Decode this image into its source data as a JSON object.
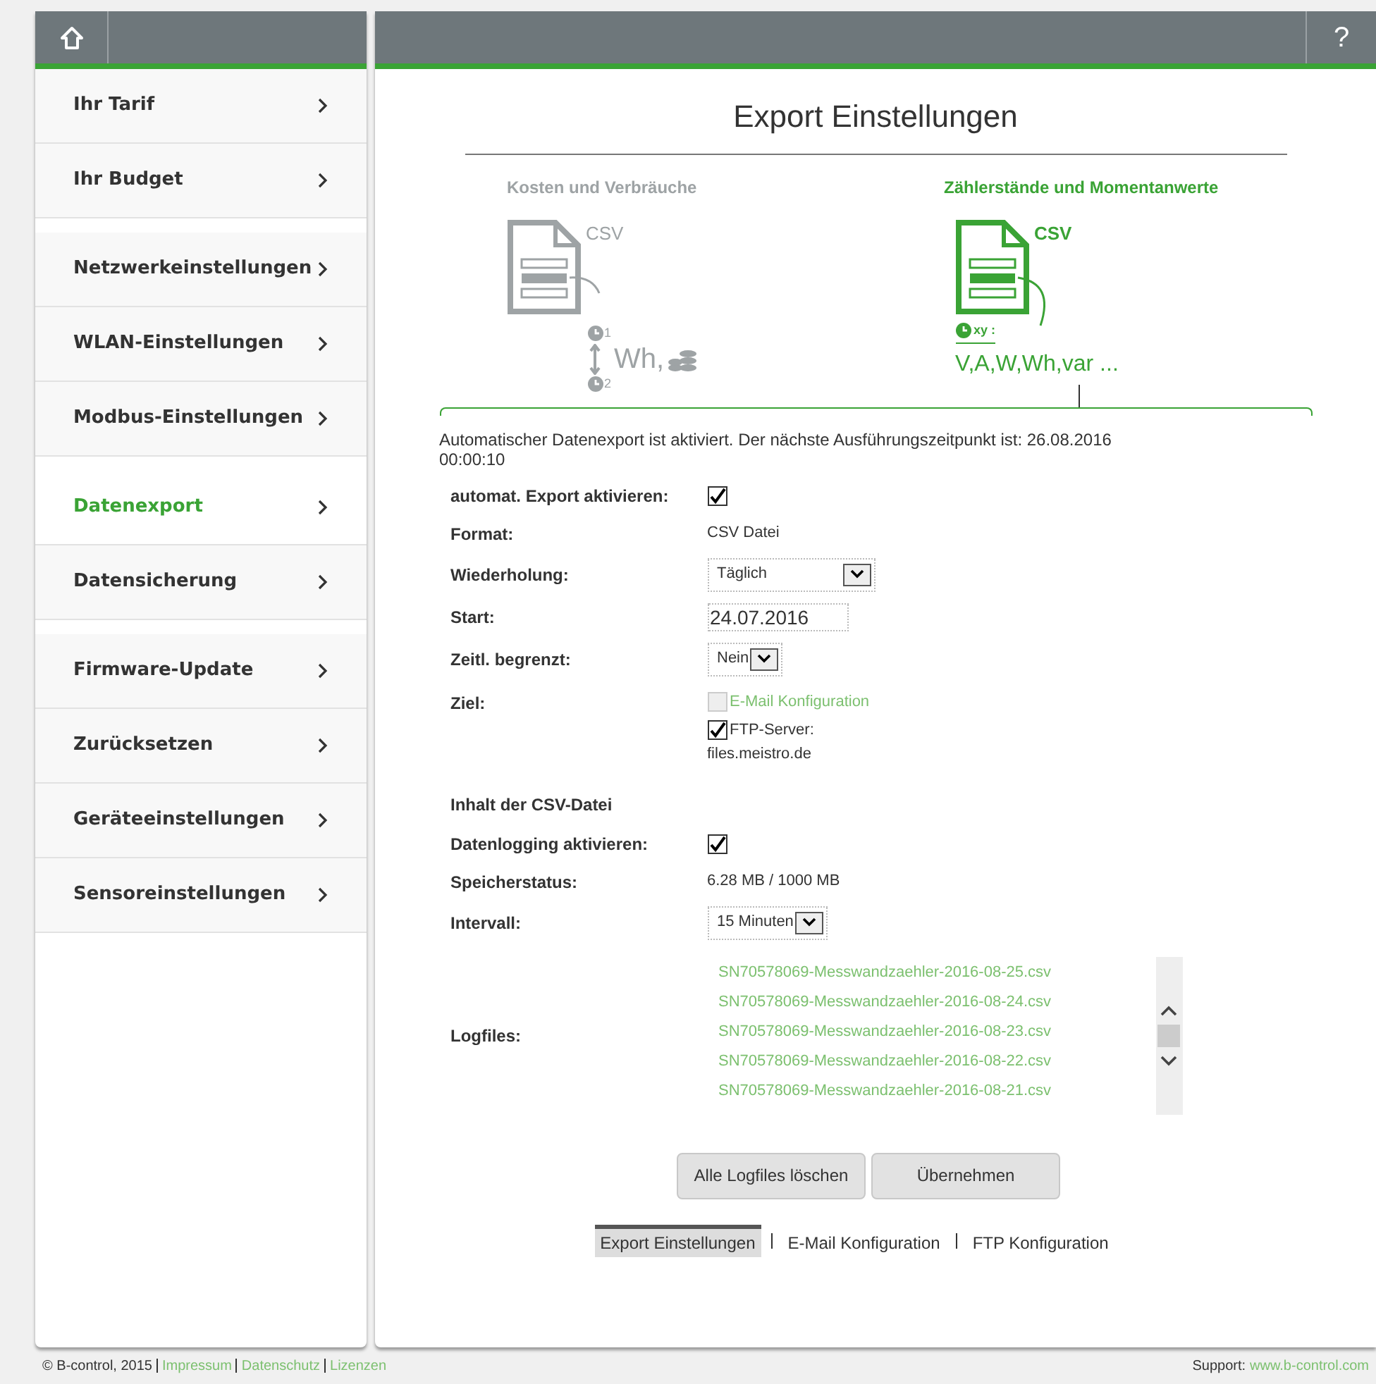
{
  "header": {
    "help": "?"
  },
  "sidebar": {
    "items": [
      {
        "label": "Ihr Tarif",
        "selected": false
      },
      {
        "label": "Ihr Budget",
        "selected": false
      },
      {
        "label": "Netzwerkeinstellungen",
        "selected": false
      },
      {
        "label": "WLAN-Einstellungen",
        "selected": false
      },
      {
        "label": "Modbus-Einstellungen",
        "selected": false
      },
      {
        "label": "Datenexport",
        "selected": true
      },
      {
        "label": "Datensicherung",
        "selected": false
      },
      {
        "label": "Firmware-Update",
        "selected": false
      },
      {
        "label": "Zurücksetzen",
        "selected": false
      },
      {
        "label": "Geräteeinstellungen",
        "selected": false
      },
      {
        "label": "Sensoreinstellungen",
        "selected": false
      }
    ]
  },
  "title": "Export Einstellungen",
  "export_types": [
    {
      "kind": "costs",
      "title": "Kosten und Verbräuche",
      "selected": false,
      "file_label": "CSV",
      "time_start": "1",
      "time_end": "2",
      "unit": "Wh,"
    },
    {
      "kind": "readings",
      "title": "Zählerstände und Momentanwerte",
      "selected": true,
      "file_label": "CSV",
      "time_label": "xy :",
      "units": "V,A,W,Wh,var ..."
    }
  ],
  "status_text": "Automatischer Datenexport ist aktiviert. Der nächste Ausführungszeitpunkt ist: 26.08.2016 00:00:10",
  "form": [
    {
      "kind": "checkbox",
      "label": "automat. Export aktivieren:",
      "checked": true
    },
    {
      "kind": "text",
      "label": "Format:",
      "value": "CSV Datei"
    },
    {
      "kind": "select",
      "label": "Wiederholung:",
      "value": "Täglich",
      "wide": true
    },
    {
      "kind": "input",
      "label": "Start:",
      "value": "24.07.2016"
    },
    {
      "kind": "select",
      "label": "Zeitl. begrenzt:",
      "value": "Nein",
      "wide": false
    },
    {
      "kind": "targets",
      "label": "Ziel:",
      "targets": [
        {
          "label": "E-Mail Konfiguration",
          "checked": false,
          "link": true
        },
        {
          "label": "FTP-Server:",
          "detail": "files.meistro.de",
          "checked": true,
          "link": false
        }
      ]
    },
    {
      "kind": "heading",
      "label": "Inhalt der CSV-Datei"
    },
    {
      "kind": "checkbox",
      "label": "Datenlogging aktivieren:",
      "checked": true
    },
    {
      "kind": "text",
      "label": "Speicherstatus:",
      "value": "6.28 MB / 1000 MB"
    },
    {
      "kind": "select",
      "label": "Intervall:",
      "value": "15 Minuten",
      "wide": false
    },
    {
      "kind": "logfiles",
      "label": "Logfiles:",
      "files": [
        "SN70578069-Messwandzaehler-2016-08-25.csv",
        "SN70578069-Messwandzaehler-2016-08-24.csv",
        "SN70578069-Messwandzaehler-2016-08-23.csv",
        "SN70578069-Messwandzaehler-2016-08-22.csv",
        "SN70578069-Messwandzaehler-2016-08-21.csv"
      ]
    }
  ],
  "buttons": [
    "Alle Logfiles löschen",
    "Übernehmen"
  ],
  "subnav": [
    {
      "label": "Export Einstellungen",
      "selected": true
    },
    {
      "label": "E-Mail Konfiguration",
      "selected": false
    },
    {
      "label": "FTP Konfiguration",
      "selected": false
    }
  ],
  "footer": {
    "copyright": "© B-control, 2015",
    "links": [
      "Impressum",
      "Datenschutz",
      "Lizenzen"
    ],
    "support_label": "Support:",
    "support_link": "www.b-control.com"
  }
}
